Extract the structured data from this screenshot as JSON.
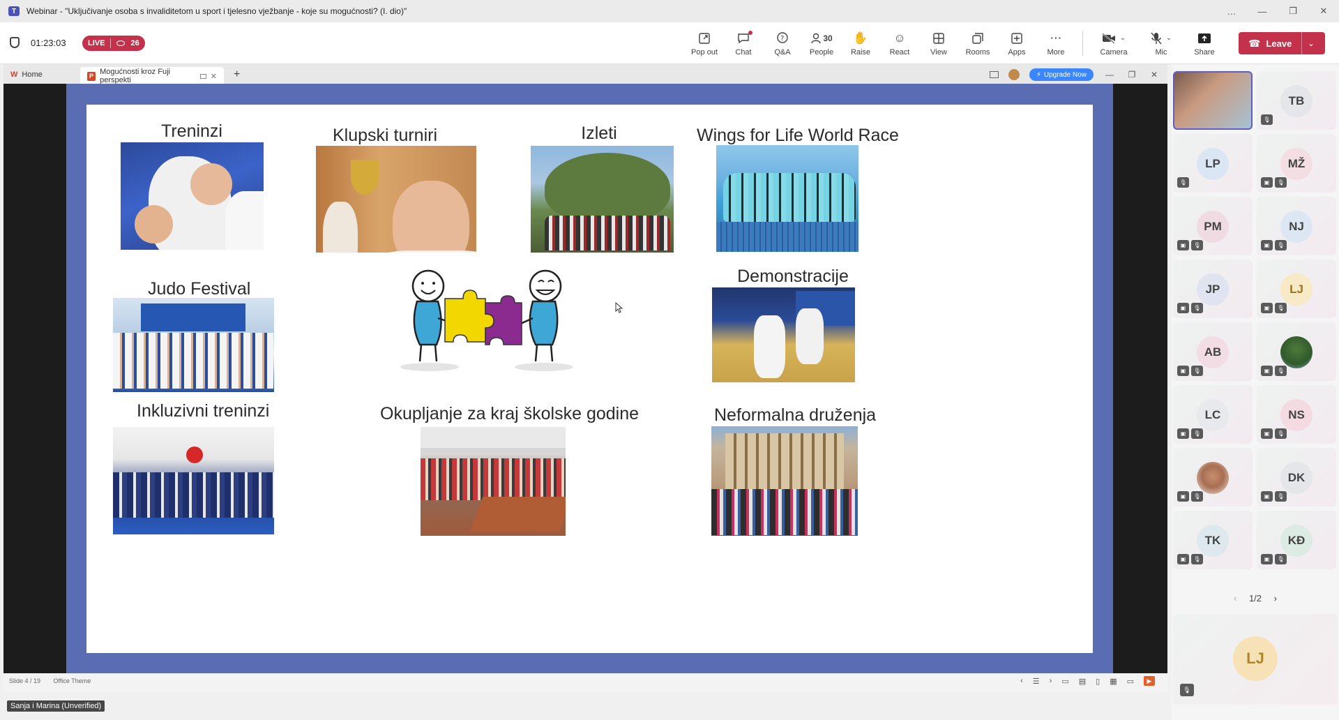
{
  "window": {
    "title": "Webinar - \"Uključivanje osoba s invaliditetom u sport i tjelesno vježbanje - koje su mogućnosti? (I. dio)\"",
    "controls": [
      "…",
      "—",
      "❐",
      "✕"
    ]
  },
  "meeting": {
    "timer": "01:23:03",
    "live_label": "LIVE",
    "viewer_count": "26",
    "tools": [
      {
        "label": "Pop out",
        "icon": "pop-out-icon"
      },
      {
        "label": "Chat",
        "icon": "chat-icon"
      },
      {
        "label": "Q&A",
        "icon": "qa-icon"
      },
      {
        "label": "People",
        "icon": "people-icon",
        "count": "30"
      },
      {
        "label": "Raise",
        "icon": "raise-hand-icon"
      },
      {
        "label": "React",
        "icon": "react-icon"
      },
      {
        "label": "View",
        "icon": "view-icon"
      },
      {
        "label": "Rooms",
        "icon": "rooms-icon"
      },
      {
        "label": "Apps",
        "icon": "apps-icon"
      },
      {
        "label": "More",
        "icon": "more-icon"
      }
    ],
    "camera_label": "Camera",
    "mic_label": "Mic",
    "share_label": "Share",
    "leave_label": "Leave",
    "leave_color": "#c4314b"
  },
  "ppt": {
    "home_tab": "Home",
    "active_tab": "Mogućnosti kroz Fuji perspekti",
    "upgrade_label": "Upgrade Now",
    "slide_info": "Slide 4 / 19",
    "theme": "Office Theme"
  },
  "slide": {
    "background_color": "#5a6cb2",
    "captions": {
      "treninzi": "Treninzi",
      "klupski": "Klupski turniri",
      "izleti": "Izleti",
      "wings": "Wings for Life World Race",
      "festival": "Judo Festival",
      "demo": "Demonstracije",
      "inklu": "Inkluzivni treninzi",
      "okup": "Okupljanje za kraj školske godine",
      "nefor": "Neformalna druženja"
    }
  },
  "presenter": "Sanja i Marina (Unverified)",
  "gallery": {
    "participants": [
      "",
      "TB",
      "LP",
      "MŽ",
      "PM",
      "NJ",
      "JP",
      "LJ",
      "AB",
      "",
      "LC",
      "NS",
      "",
      "DK",
      "TK",
      "KĐ"
    ],
    "pager": "1/2",
    "spotlight": "LJ"
  }
}
